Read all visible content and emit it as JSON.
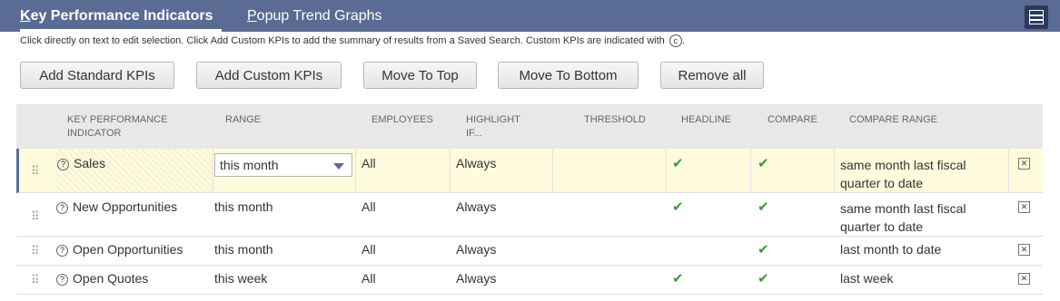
{
  "tabs": {
    "active_label_ul": "K",
    "active_label_rest": "ey Performance Indicators",
    "inactive_label_ul": "P",
    "inactive_label_rest": "opup Trend Graphs"
  },
  "instructions": {
    "text": "Click directly on text to edit selection. Click Add Custom KPIs to add the summary of results from a Saved Search. Custom KPIs are indicated with",
    "icon_glyph": "c",
    "suffix": "."
  },
  "buttons": {
    "add_standard": "Add Standard KPIs",
    "add_custom": "Add Custom KPIs",
    "move_top": "Move To Top",
    "move_bottom": "Move To Bottom",
    "remove_all": "Remove all"
  },
  "columns": {
    "kpi_line1": "KEY PERFORMANCE",
    "kpi_line2": "INDICATOR",
    "range": "RANGE",
    "employees": "EMPLOYEES",
    "highlight_line1": "HIGHLIGHT",
    "highlight_line2": "IF...",
    "threshold": "THRESHOLD",
    "headline": "HEADLINE",
    "compare": "COMPARE",
    "compare_range": "COMPARE RANGE"
  },
  "rows": [
    {
      "kpi": "Sales",
      "range": "this month",
      "employees": "All",
      "highlight": "Always",
      "headline": "✔",
      "compare": "✔",
      "compare_range_1": "same month last fiscal",
      "compare_range_2": "quarter to date"
    },
    {
      "kpi": "New Opportunities",
      "range": "this month",
      "employees": "All",
      "highlight": "Always",
      "headline": "✔",
      "compare": "✔",
      "compare_range_1": "same month last fiscal",
      "compare_range_2": "quarter to date"
    },
    {
      "kpi": "Open Opportunities",
      "range": "this month",
      "employees": "All",
      "highlight": "Always",
      "headline": "",
      "compare": "✔",
      "compare_range_1": "last month to date",
      "compare_range_2": ""
    },
    {
      "kpi": "Open Quotes",
      "range": "this week",
      "employees": "All",
      "highlight": "Always",
      "headline": "✔",
      "compare": "✔",
      "compare_range_1": "last week",
      "compare_range_2": ""
    }
  ],
  "glyphs": {
    "drag": "⠿",
    "help": "?",
    "delete": "✕"
  },
  "colors": {
    "tab_bar": "#5a6c93",
    "selected_row": "#fffbdc",
    "check": "#3a9a3a"
  }
}
